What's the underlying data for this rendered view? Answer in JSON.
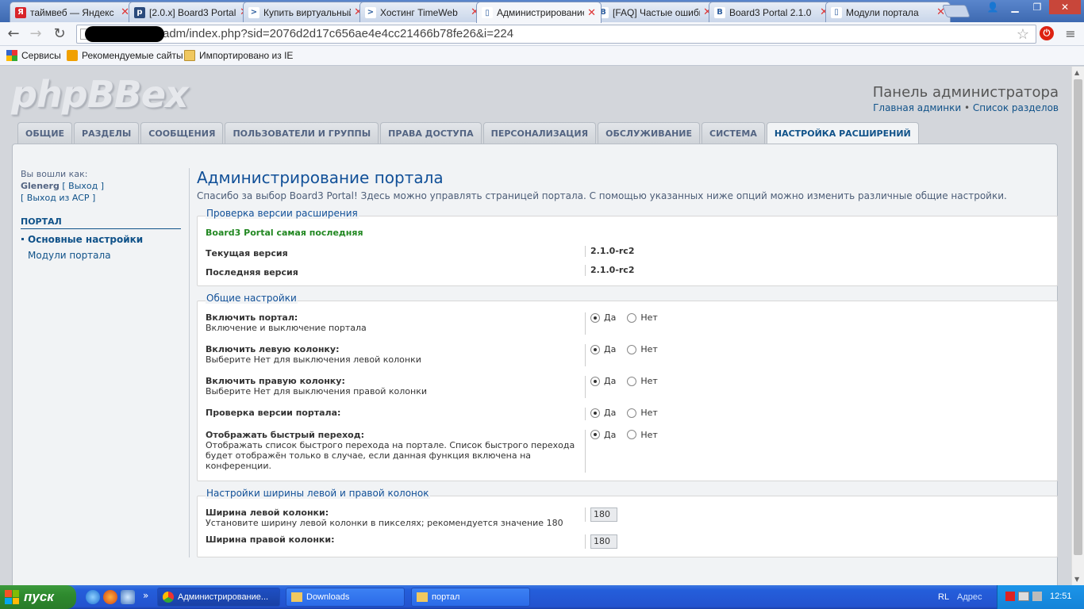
{
  "browser": {
    "tabs": [
      {
        "title": "таймвеб — Яндекс",
        "fav_color": "#d8242a",
        "fav_letter": "Я"
      },
      {
        "title": "[2.0.x] Board3 Portal",
        "fav_color": "#2a4a7c",
        "fav_letter": "p"
      },
      {
        "title": "Купить виртуальный",
        "fav_color": "#ffffff",
        "fav_letter": ">"
      },
      {
        "title": "Хостинг TimeWeb",
        "fav_color": "#ffffff",
        "fav_letter": ">"
      },
      {
        "title": "Администрирование",
        "fav_color": "#ffffff",
        "fav_letter": "▯"
      },
      {
        "title": "[FAQ] Частые ошибки",
        "fav_color": "#ffffff",
        "fav_letter": "B"
      },
      {
        "title": "Board3 Portal 2.1.0",
        "fav_color": "#ffffff",
        "fav_letter": "B"
      },
      {
        "title": "Модули портала",
        "fav_color": "#ffffff",
        "fav_letter": "▯"
      }
    ],
    "url": "adm/index.php?sid=2076d2d17c656ae4e4cc21466b78fe26&i=224",
    "bookmarks": [
      "Сервисы",
      "Рекомендуемые сайты",
      "Импортировано из IE"
    ]
  },
  "header": {
    "logo": "phpBBex",
    "admin_title": "Панель администратора",
    "link_home": "Главная админки",
    "link_sep": "•",
    "link_forums": "Список разделов"
  },
  "nav_tabs": [
    {
      "label": "ОБЩИЕ",
      "active": false
    },
    {
      "label": "РАЗДЕЛЫ",
      "active": false
    },
    {
      "label": "СООБЩЕНИЯ",
      "active": false
    },
    {
      "label": "ПОЛЬЗОВАТЕЛИ И ГРУППЫ",
      "active": false
    },
    {
      "label": "ПРАВА ДОСТУПА",
      "active": false
    },
    {
      "label": "ПЕРСОНАЛИЗАЦИЯ",
      "active": false
    },
    {
      "label": "ОБСЛУЖИВАНИЕ",
      "active": false
    },
    {
      "label": "СИСТЕМА",
      "active": false
    },
    {
      "label": "НАСТРОЙКА РАСШИРЕНИЙ",
      "active": true
    }
  ],
  "sidebar": {
    "logged_as": "Вы вошли как:",
    "username": "Glenerg",
    "logout": "[ Выход ]",
    "logout_acp": "[ Выход из ACP ]",
    "menu_head": "ПОРТАЛ",
    "items": [
      {
        "label": "Основные настройки",
        "active": true
      },
      {
        "label": "Модули портала",
        "active": false
      }
    ]
  },
  "main": {
    "title": "Администрирование портала",
    "intro": "Спасибо за выбор Board3 Portal! Здесь можно управлять страницей портала. С помощью указанных ниже опций можно изменить различные общие настройки.",
    "version": {
      "legend": "Проверка версии расширения",
      "status": "Board3 Portal самая последняя",
      "current_label": "Текущая версия",
      "current_value": "2.1.0-rc2",
      "latest_label": "Последняя версия",
      "latest_value": "2.1.0-rc2"
    },
    "general": {
      "legend": "Общие настройки",
      "yes": "Да",
      "no": "Нет",
      "rows": [
        {
          "label": "Включить портал:",
          "explain": "Включение и выключение портала",
          "value": "yes"
        },
        {
          "label": "Включить левую колонку:",
          "explain": "Выберите Нет для выключения левой колонки",
          "value": "yes"
        },
        {
          "label": "Включить правую колонку:",
          "explain": "Выберите Нет для выключения правой колонки",
          "value": "yes"
        },
        {
          "label": "Проверка версии портала:",
          "explain": "",
          "value": "yes"
        },
        {
          "label": "Отображать быстрый переход:",
          "explain": "Отображать список быстрого перехода на портале. Список быстрого перехода будет отображён только в случае, если данная функция включена на конференции.",
          "value": "yes"
        }
      ]
    },
    "width": {
      "legend": "Настройки ширины левой и правой колонок",
      "left_label": "Ширина левой колонки:",
      "left_explain": "Установите ширину левой колонки в пикселях; рекомендуется значение 180",
      "left_value": "180",
      "right_label": "Ширина правой колонки:",
      "right_value": "180"
    }
  },
  "taskbar": {
    "start": "пуск",
    "buttons": [
      {
        "label": "Администрирование...",
        "active": true
      },
      {
        "label": "Downloads",
        "active": false
      },
      {
        "label": "портал",
        "active": false
      }
    ],
    "lang": "RL",
    "address": "Адрес",
    "clock": "12:51"
  }
}
